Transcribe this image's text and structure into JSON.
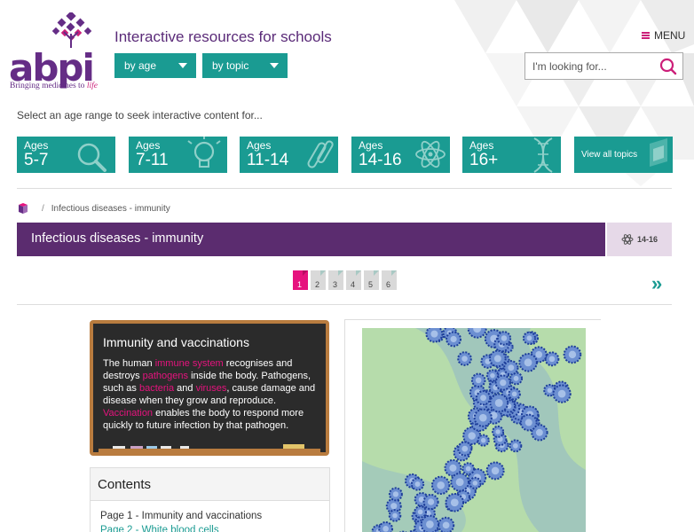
{
  "header": {
    "logo_text": "abpi",
    "logo_tagline_prefix": "Bringing medicines to",
    "logo_tagline_emph": "life",
    "site_title": "Interactive resources for schools",
    "dropdowns": [
      {
        "label": "by age"
      },
      {
        "label": "by topic"
      }
    ],
    "menu_label": "MENU",
    "search_placeholder": "I'm looking for..."
  },
  "age_prompt": "Select an age range to seek interactive content for...",
  "age_tiles": [
    {
      "label": "Ages",
      "range": "5-7",
      "icon": "magnifier-icon"
    },
    {
      "label": "Ages",
      "range": "7-11",
      "icon": "lightbulb-icon"
    },
    {
      "label": "Ages",
      "range": "11-14",
      "icon": "test-tubes-icon"
    },
    {
      "label": "Ages",
      "range": "14-16",
      "icon": "atom-icon"
    },
    {
      "label": "Ages",
      "range": "16+",
      "icon": "dna-icon"
    },
    {
      "label": "View all topics",
      "icon": "cube-icon"
    }
  ],
  "breadcrumb": {
    "home_icon": "home-cube-icon",
    "separator": "/",
    "current": "Infectious diseases - immunity"
  },
  "banner": {
    "title": "Infectious diseases - immunity",
    "age_badge": "14-16",
    "badge_icon": "atom-icon"
  },
  "pagination": {
    "pages": [
      "1",
      "2",
      "3",
      "4",
      "5",
      "6"
    ],
    "active": "1",
    "next_icon": "double-chevron-right-icon"
  },
  "chalkboard": {
    "title": "Immunity and vaccinations",
    "segments": [
      {
        "text": "The human ",
        "hl": false
      },
      {
        "text": "immune system",
        "hl": true
      },
      {
        "text": " recognises and destroys ",
        "hl": false
      },
      {
        "text": "pathogens",
        "hl": true
      },
      {
        "text": " inside the body. Pathogens, such as ",
        "hl": false
      },
      {
        "text": "bacteria",
        "hl": true
      },
      {
        "text": " and ",
        "hl": false
      },
      {
        "text": "viruses",
        "hl": true
      },
      {
        "text": ", cause damage and disease when they grow and reproduce. ",
        "hl": false
      },
      {
        "text": "Vaccination",
        "hl": true
      },
      {
        "text": " enables the body to respond more quickly to future infection by that pathogen.",
        "hl": false
      }
    ]
  },
  "contents": {
    "title": "Contents",
    "items": [
      {
        "label": "Page 1 - Immunity and vaccinations",
        "link": false
      },
      {
        "label": "Page 2 - White blood cells",
        "link": true
      }
    ]
  },
  "colors": {
    "purple": "#5b2c6f",
    "teal": "#1a9b92",
    "pink": "#e6137e",
    "frame": "#b97c3f"
  }
}
